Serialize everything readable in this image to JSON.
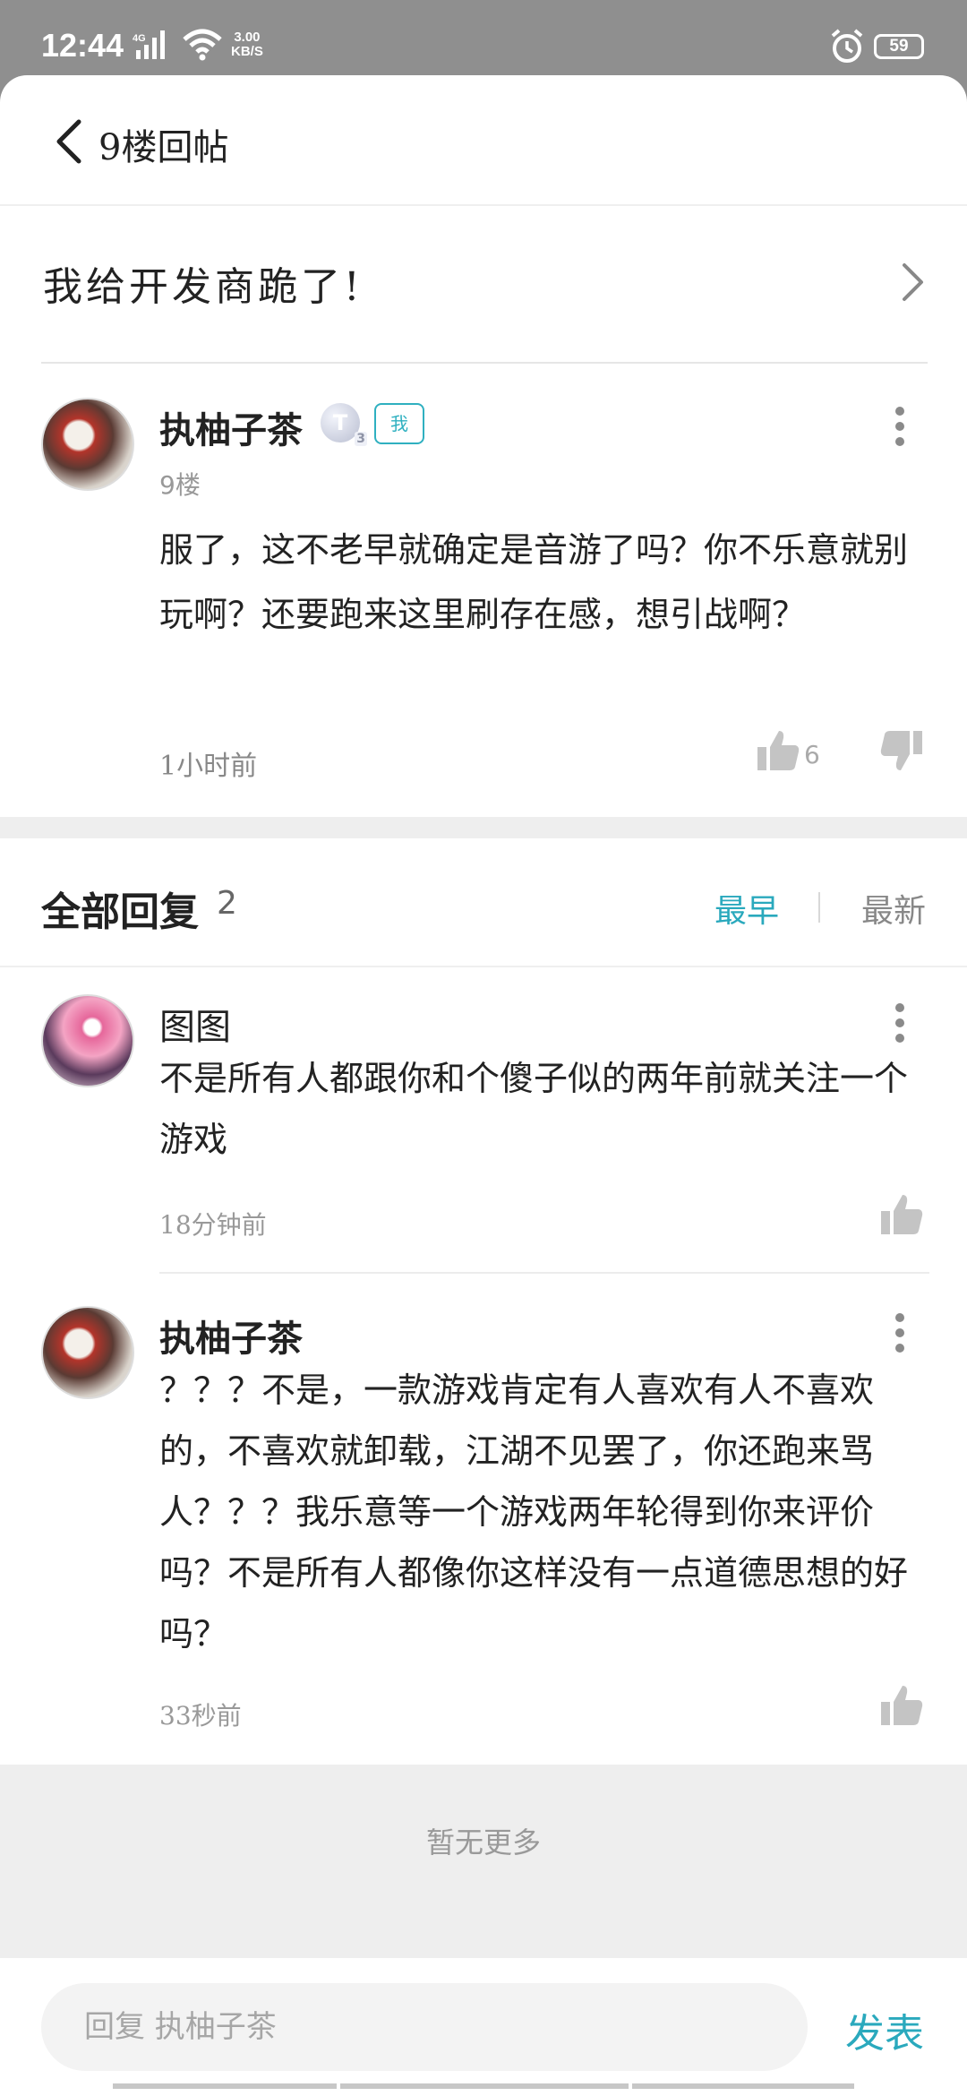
{
  "status_bar": {
    "time": "12:44",
    "network": "4G",
    "speed_value": "3.00",
    "speed_unit": "KB/S",
    "battery": "59"
  },
  "header": {
    "title": "9楼回帖"
  },
  "thread": {
    "title": "我给开发商跪了!"
  },
  "post": {
    "username": "执柚子茶",
    "level": "T",
    "level_sub": "3",
    "me_badge": "我",
    "floor": "9楼",
    "content": "服了，这不老早就确定是音游了吗？你不乐意就别玩啊？还要跑来这里刷存在感，想引战啊？",
    "time": "1小时前",
    "likes": "6"
  },
  "replies_header": {
    "title": "全部回复",
    "count": "2",
    "sort_earliest": "最早",
    "sort_newest": "最新",
    "active_color": "#2aa9bd"
  },
  "replies": [
    {
      "username": "图图",
      "content": "不是所有人都跟你和个傻子似的两年前就关注一个游戏",
      "time": "18分钟前"
    },
    {
      "username": "执柚子茶",
      "content": "？？？不是，一款游戏肯定有人喜欢有人不喜欢的，不喜欢就卸载，江湖不见罢了，你还跑来骂人？？？我乐意等一个游戏两年轮得到你来评价吗？不是所有人都像你这样没有一点道德思想的好吗？",
      "time": "33秒前"
    }
  ],
  "footer": {
    "no_more": "暂无更多"
  },
  "input": {
    "placeholder": "回复 执柚子茶",
    "send_label": "发表"
  }
}
